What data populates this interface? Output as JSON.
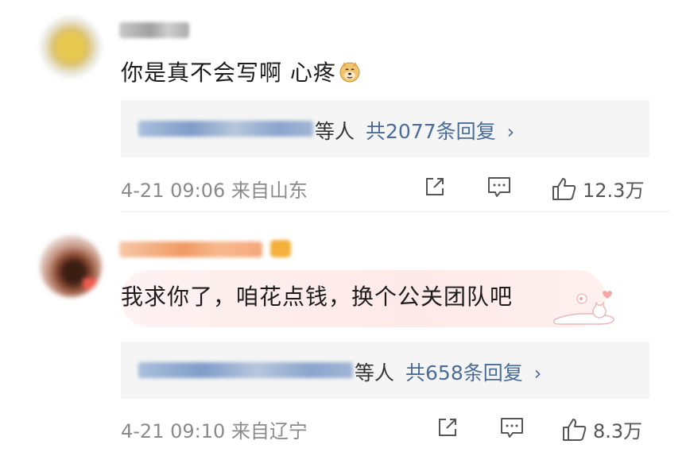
{
  "comments": [
    {
      "text": "你是真不会写啊 心疼",
      "emoji": "doge-emoji",
      "reply_suffix": "等人",
      "reply_count": "共2077条回复",
      "timestamp": "4-21 09:06 来自山东",
      "likes": "12.3万"
    },
    {
      "text": "我求你了，咱花点钱，换个公关团队吧",
      "reply_suffix": "等人",
      "reply_count": "共658条回复",
      "timestamp": "4-21 09:10 来自辽宁",
      "likes": "8.3万"
    }
  ],
  "icons": {
    "chevron": "›",
    "share": "share-icon",
    "comment": "comment-icon",
    "like": "like-icon"
  },
  "colors": {
    "link": "#4a6c9a",
    "meta": "#8a8a8a",
    "reply_bg": "#f5f5f5"
  }
}
